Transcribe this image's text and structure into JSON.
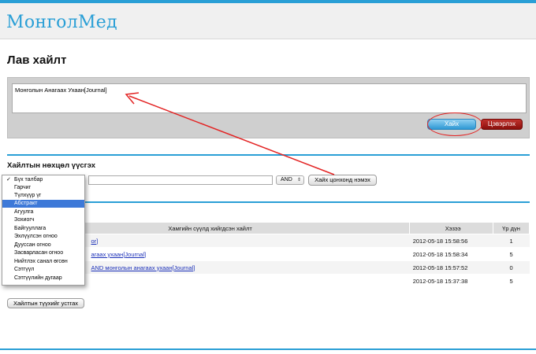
{
  "header": {
    "logo": "МонголМед"
  },
  "page": {
    "title": "Лав хайлт"
  },
  "search": {
    "query": "Монголын Анагаах Ухаан[Journal]",
    "search_label": "Хайх",
    "clear_label": "Цэвэрлэх"
  },
  "builder": {
    "title": "Хайлтын нөхцөл үүсгэх",
    "operator": "AND",
    "add_label": "Хайх цонхонд нэмэх",
    "fields": [
      "Бүх талбар",
      "Гарчиг",
      "Түлхүүр үг",
      "Абстракт",
      "Агуулга",
      "Зохиогч",
      "Байгууллага",
      "Эхлүүлсэн огноо",
      "Дууссан огноо",
      "Засварласан огноо",
      "Нийтлэх санал өгсөн",
      "Сэтгүүл",
      "Сэтгүүлийн дугаар"
    ],
    "checked_index": 0,
    "highlighted_index": 3
  },
  "history": {
    "headers": {
      "query": "Хамгийн сүүлд хийгдсэн хайлт",
      "date": "Хэзээ",
      "count": "Үр дүн"
    },
    "rows": [
      {
        "query": "or]",
        "date": "2012-05-18 15:58:56",
        "count": "1"
      },
      {
        "query": "агаах ухаан[Journal]",
        "date": "2012-05-18 15:58:34",
        "count": "5"
      },
      {
        "query": "AND монголын анагаах ухаан[Journal]",
        "date": "2012-05-18 15:57:52",
        "count": "0"
      },
      {
        "query": "",
        "date": "2012-05-18 15:37:38",
        "count": "5"
      }
    ],
    "clear_label": "Хайлтын түүхийг устгах"
  },
  "colors": {
    "accent": "#2a9fd6",
    "danger": "#8a0f0c",
    "annotation": "#e32424",
    "dropdown_highlight": "#3d79d8"
  }
}
